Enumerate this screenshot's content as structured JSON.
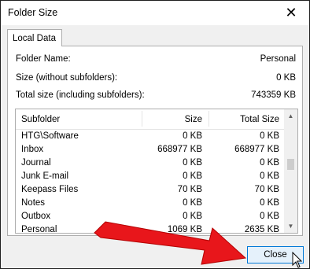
{
  "window": {
    "title": "Folder Size"
  },
  "tabs": [
    {
      "label": "Local Data"
    }
  ],
  "info": [
    {
      "label": "Folder Name:",
      "value": "Personal"
    },
    {
      "label": "Size (without subfolders):",
      "value": "0 KB"
    },
    {
      "label": "Total size (including subfolders):",
      "value": "743359 KB"
    }
  ],
  "table": {
    "columns": [
      "Subfolder",
      "Size",
      "Total Size"
    ],
    "rows": [
      [
        "HTG\\Software",
        "0 KB",
        "0 KB"
      ],
      [
        "Inbox",
        "668977 KB",
        "668977 KB"
      ],
      [
        "Journal",
        "0 KB",
        "0 KB"
      ],
      [
        "Junk E-mail",
        "0 KB",
        "0 KB"
      ],
      [
        "Keepass Files",
        "70 KB",
        "70 KB"
      ],
      [
        "Notes",
        "0 KB",
        "0 KB"
      ],
      [
        "Outbox",
        "0 KB",
        "0 KB"
      ],
      [
        "Personal",
        "1069 KB",
        "2635 KB"
      ]
    ]
  },
  "buttons": {
    "close": "Close"
  },
  "icons": {
    "window_close": "close-icon",
    "scroll_up": "chevron-up-icon",
    "scroll_down": "chevron-down-icon",
    "pointer": "cursor-icon",
    "annotation": "red-arrow-icon"
  },
  "colors": {
    "accent": "#0078d7",
    "arrow": "#e8161b",
    "button_bg": "#e5f1fb"
  }
}
